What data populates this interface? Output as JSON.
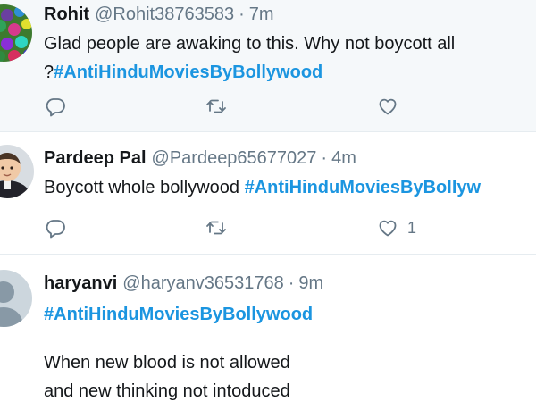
{
  "tweets": [
    {
      "name": "Rohit",
      "handle": "@Rohit38763583",
      "separator": "·",
      "time": "7m",
      "text_line1": "Glad people are awaking to this. Why not boycott all",
      "text_line2_prefix": "?",
      "hashtag": "#AntiHinduMoviesByBollywood",
      "like_count": ""
    },
    {
      "name": "Pardeep Pal",
      "handle": "@Pardeep65677027",
      "separator": "·",
      "time": "4m",
      "text_prefix": "Boycott whole bollywood ",
      "hashtag": "#AntiHinduMoviesByBollyw",
      "like_count": "1"
    },
    {
      "name": "haryanvi",
      "handle": "@haryanv36531768",
      "separator": "·",
      "time": "9m",
      "hashtag": "#AntiHinduMoviesByBollywood",
      "body_line1": "When new blood is not allowed",
      "body_line2": "and new thinking not intoduced"
    }
  ],
  "icons": {
    "reply": "reply-icon",
    "retweet": "retweet-icon",
    "like": "heart-icon"
  },
  "colors": {
    "hashtag": "#1b95e0",
    "muted": "#657786",
    "highlight_bg": "#f5f8fa",
    "divider": "#e6ecf0"
  }
}
